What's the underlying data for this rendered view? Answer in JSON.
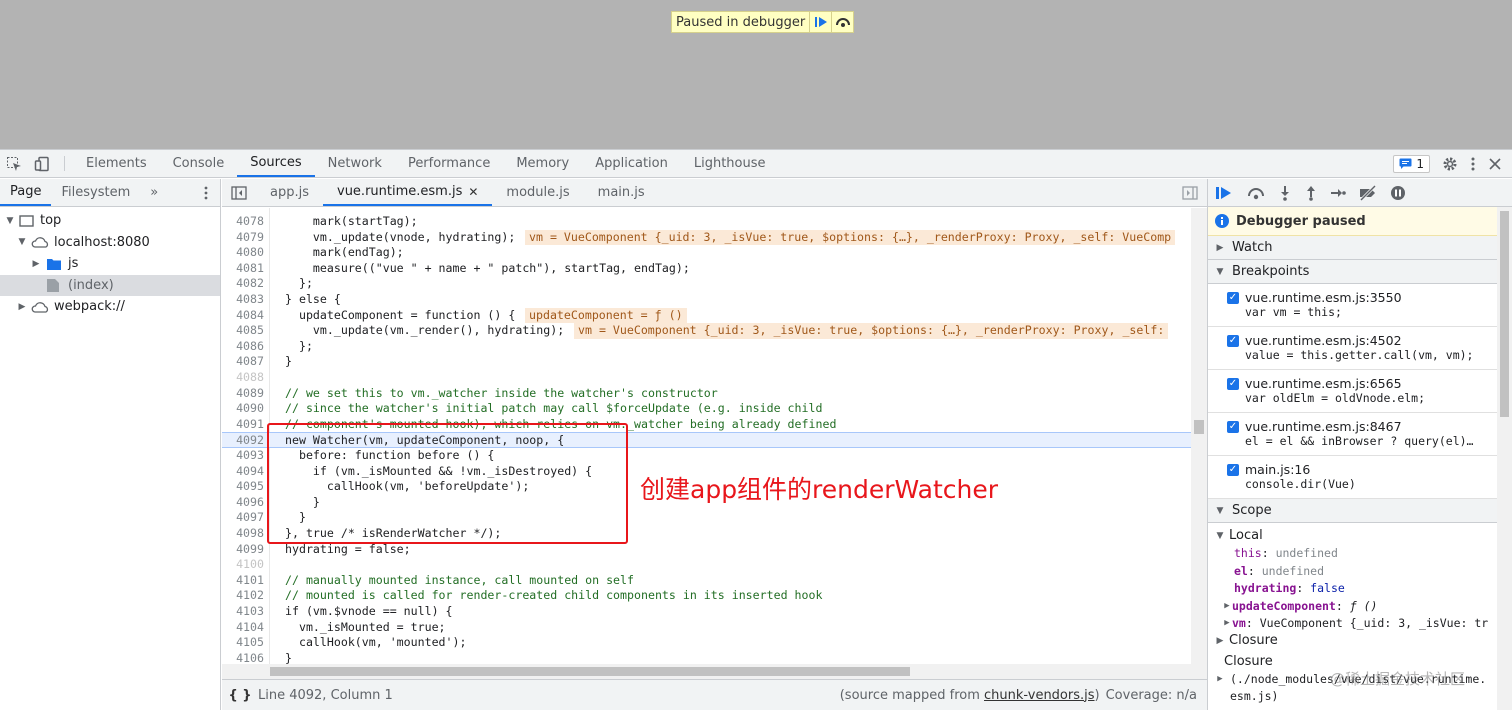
{
  "banner": {
    "text": "Paused in debugger"
  },
  "devtools_tabs": [
    "Elements",
    "Console",
    "Sources",
    "Network",
    "Performance",
    "Memory",
    "Application",
    "Lighthouse"
  ],
  "issues_count": "1",
  "navigator": {
    "tabs": [
      "Page",
      "Filesystem"
    ],
    "more": "»",
    "tree": [
      {
        "label": "top",
        "indent": 0,
        "arrow": "▼",
        "icon": "frame-icon"
      },
      {
        "label": "localhost:8080",
        "indent": 1,
        "arrow": "▼",
        "icon": "cloud-icon"
      },
      {
        "label": "js",
        "indent": 2,
        "arrow": "▶",
        "icon": "folder-icon"
      },
      {
        "label": "(index)",
        "indent": 2,
        "arrow": "",
        "icon": "file-icon",
        "selected": true
      },
      {
        "label": "webpack://",
        "indent": 1,
        "arrow": "▶",
        "icon": "cloud-icon"
      }
    ]
  },
  "file_tabs": [
    "app.js",
    "vue.runtime.esm.js",
    "module.js",
    "main.js"
  ],
  "active_file": "vue.runtime.esm.js",
  "code_lines": [
    {
      "n": "4078",
      "code": "    mark(startTag);"
    },
    {
      "n": "4079",
      "code": "    vm._update(vnode, hydrating);",
      "inline": "vm = VueComponent {_uid: 3, _isVue: true, $options: {…}, _renderProxy: Proxy, _self: VueComp"
    },
    {
      "n": "4080",
      "code": "    mark(endTag);"
    },
    {
      "n": "4081",
      "code": "    measure((\"vue \" + name + \" patch\"), startTag, endTag);"
    },
    {
      "n": "4082",
      "code": "  };"
    },
    {
      "n": "4083",
      "code": "} else {"
    },
    {
      "n": "4084",
      "code": "  updateComponent = function () {",
      "inline": "updateComponent = ƒ ()"
    },
    {
      "n": "4085",
      "code": "    vm._update(vm._render(), hydrating);",
      "inline": "vm = VueComponent {_uid: 3, _isVue: true, $options: {…}, _renderProxy: Proxy, _self:"
    },
    {
      "n": "4086",
      "code": "  };"
    },
    {
      "n": "4087",
      "code": "}"
    },
    {
      "n": "4088",
      "code": "",
      "dim": true
    },
    {
      "n": "4089",
      "code": "// we set this to vm._watcher inside the watcher's constructor",
      "comment": true
    },
    {
      "n": "4090",
      "code": "// since the watcher's initial patch may call $forceUpdate (e.g. inside child",
      "comment": true
    },
    {
      "n": "4091",
      "code": "// component's mounted hook), which relies on vm._watcher being already defined",
      "comment": true
    },
    {
      "n": "4092",
      "code": "new Watcher(vm, updateComponent, noop, {",
      "exec": true
    },
    {
      "n": "4093",
      "code": "  before: function before () {"
    },
    {
      "n": "4094",
      "code": "    if (vm._isMounted && !vm._isDestroyed) {"
    },
    {
      "n": "4095",
      "code": "      callHook(vm, 'beforeUpdate');"
    },
    {
      "n": "4096",
      "code": "    }"
    },
    {
      "n": "4097",
      "code": "  }"
    },
    {
      "n": "4098",
      "code": "}, true /* isRenderWatcher */);"
    },
    {
      "n": "4099",
      "code": "hydrating = false;"
    },
    {
      "n": "4100",
      "code": "",
      "dim": true
    },
    {
      "n": "4101",
      "code": "// manually mounted instance, call mounted on self",
      "comment": true
    },
    {
      "n": "4102",
      "code": "// mounted is called for render-created child components in its inserted hook",
      "comment": true
    },
    {
      "n": "4103",
      "code": "if (vm.$vnode == null) {"
    },
    {
      "n": "4104",
      "code": "  vm._isMounted = true;"
    },
    {
      "n": "4105",
      "code": "  callHook(vm, 'mounted');"
    },
    {
      "n": "4106",
      "code": "}"
    }
  ],
  "annotation": "创建app组件的renderWatcher",
  "status": {
    "position": "Line 4092, Column 1",
    "mapped_prefix": "(source mapped from ",
    "mapped_file": "chunk-vendors.js",
    "mapped_suffix": ")",
    "coverage": "Coverage: n/a"
  },
  "debugger": {
    "paused": "Debugger paused",
    "watch": "Watch",
    "breakpoints_title": "Breakpoints",
    "breakpoints": [
      {
        "loc": "vue.runtime.esm.js:3550",
        "snippet": "var vm = this;"
      },
      {
        "loc": "vue.runtime.esm.js:4502",
        "snippet": "value = this.getter.call(vm, vm);"
      },
      {
        "loc": "vue.runtime.esm.js:6565",
        "snippet": "var oldElm = oldVnode.elm;"
      },
      {
        "loc": "vue.runtime.esm.js:8467",
        "snippet": "el = el && inBrowser ? query(el)…"
      },
      {
        "loc": "main.js:16",
        "snippet": "console.dir(Vue)"
      }
    ],
    "scope_title": "Scope",
    "local_title": "Local",
    "scope_vars": [
      {
        "name": "this",
        "value": "undefined",
        "bold": false,
        "arrow": ""
      },
      {
        "name": "el",
        "value": "undefined",
        "bold": true,
        "arrow": ""
      },
      {
        "name": "hydrating",
        "value": "false",
        "bold": true,
        "arrow": ""
      },
      {
        "name": "updateComponent",
        "value": "ƒ ()",
        "bold": true,
        "arrow": "▶"
      },
      {
        "name": "vm",
        "value": "VueComponent {_uid: 3, _isVue: tr",
        "bold": true,
        "arrow": "▶"
      }
    ],
    "closure1": "Closure",
    "closure2": "Closure",
    "closure2_detail": "(./node_modules/vue/dist/vue.runtime.",
    "closure2_detail2": "esm.js)"
  },
  "watermark": "@稀土掘金技术社区",
  "colors": {
    "accent": "#1a73e8",
    "annotation": "#e8161b",
    "exec_line": "#e8f0fe",
    "inline_value": "#fbe9d7"
  }
}
